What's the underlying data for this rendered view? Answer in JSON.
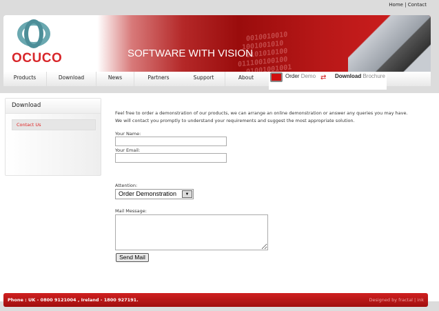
{
  "top_links": {
    "home": "Home",
    "sep": " | ",
    "contact": "Contact"
  },
  "logo": {
    "text": "OCUCO"
  },
  "banner": {
    "tagline": "SOFTWARE WITH VISION",
    "binary": "  0010010010\n 1001001010\n  0101010100\n011100100100\n  01001001001"
  },
  "nav": [
    {
      "label": "Products"
    },
    {
      "label": "Download"
    },
    {
      "label": "News"
    },
    {
      "label": "Partners"
    },
    {
      "label": "Support"
    },
    {
      "label": "About"
    }
  ],
  "promo": {
    "order": "Order",
    "demo": "Demo",
    "download": "Download",
    "brochure": "Brochure"
  },
  "sidebar": {
    "title": "Download",
    "items": [
      {
        "label": "Contact Us"
      }
    ]
  },
  "content": {
    "intro1": "Feel free to order a demonstration of our products, we can arrange an online demonstration or answer any queries you may have.",
    "intro2": "We will contact you promptly to understand your requirements and suggest the most appropriate solution.",
    "name_label": "Your Name:",
    "name_value": "",
    "email_label": "Your Email:",
    "email_value": "",
    "attention_label": "Attention:",
    "attention_value": "Order Demonstration",
    "message_label": "Mail Message:",
    "send_label": "Send Mail"
  },
  "footer": {
    "phone": "Phone : UK - 0800 9121004 , Ireland - 1800 927191.",
    "credit": "Designed by fractal | ink"
  },
  "colors": {
    "brand_red": "#c81a1a",
    "link_red": "#e02020"
  }
}
